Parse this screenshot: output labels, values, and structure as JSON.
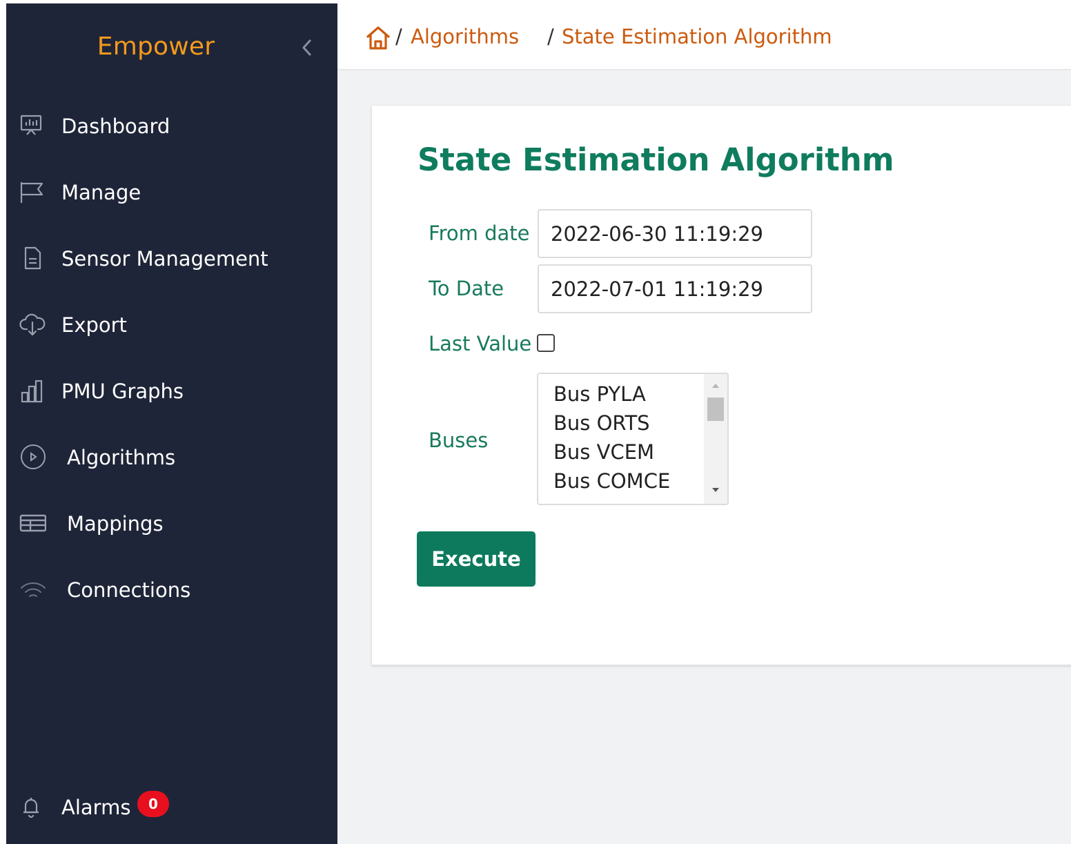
{
  "app": {
    "brand": "Empower"
  },
  "sidebar": {
    "items": [
      {
        "label": "Dashboard",
        "icon": "presentation-board-icon"
      },
      {
        "label": "Manage",
        "icon": "flag-icon"
      },
      {
        "label": "Sensor Management",
        "icon": "document-icon"
      },
      {
        "label": "Export",
        "icon": "cloud-download-icon"
      },
      {
        "label": "PMU Graphs",
        "icon": "bar-chart-icon"
      },
      {
        "label": "Algorithms",
        "icon": "play-circle-icon"
      },
      {
        "label": "Mappings",
        "icon": "table-icon"
      },
      {
        "label": "Connections",
        "icon": "wifi-icon"
      }
    ],
    "alarms": {
      "label": "Alarms",
      "count": "0",
      "icon": "bell-icon"
    }
  },
  "breadcrumb": {
    "separator": "/",
    "items": [
      "Algorithms",
      "State Estimation Algorithm"
    ]
  },
  "form": {
    "title": "State Estimation Algorithm",
    "from_label": "From date",
    "from_value": "2022-06-30 11:19:29",
    "to_label": "To Date",
    "to_value": "2022-07-01 11:19:29",
    "last_value_label": "Last Value",
    "last_value_checked": false,
    "buses_label": "Buses",
    "buses_options": [
      "Bus PYLA",
      "Bus ORTS",
      "Bus VCEM",
      "Bus COMCE"
    ],
    "execute_label": "Execute"
  },
  "colors": {
    "sidebar_bg": "#1f2538",
    "brand": "#f39a1c",
    "accent_green": "#0d7a5d",
    "link_orange": "#cc5a0e",
    "badge_red": "#e8101e"
  }
}
